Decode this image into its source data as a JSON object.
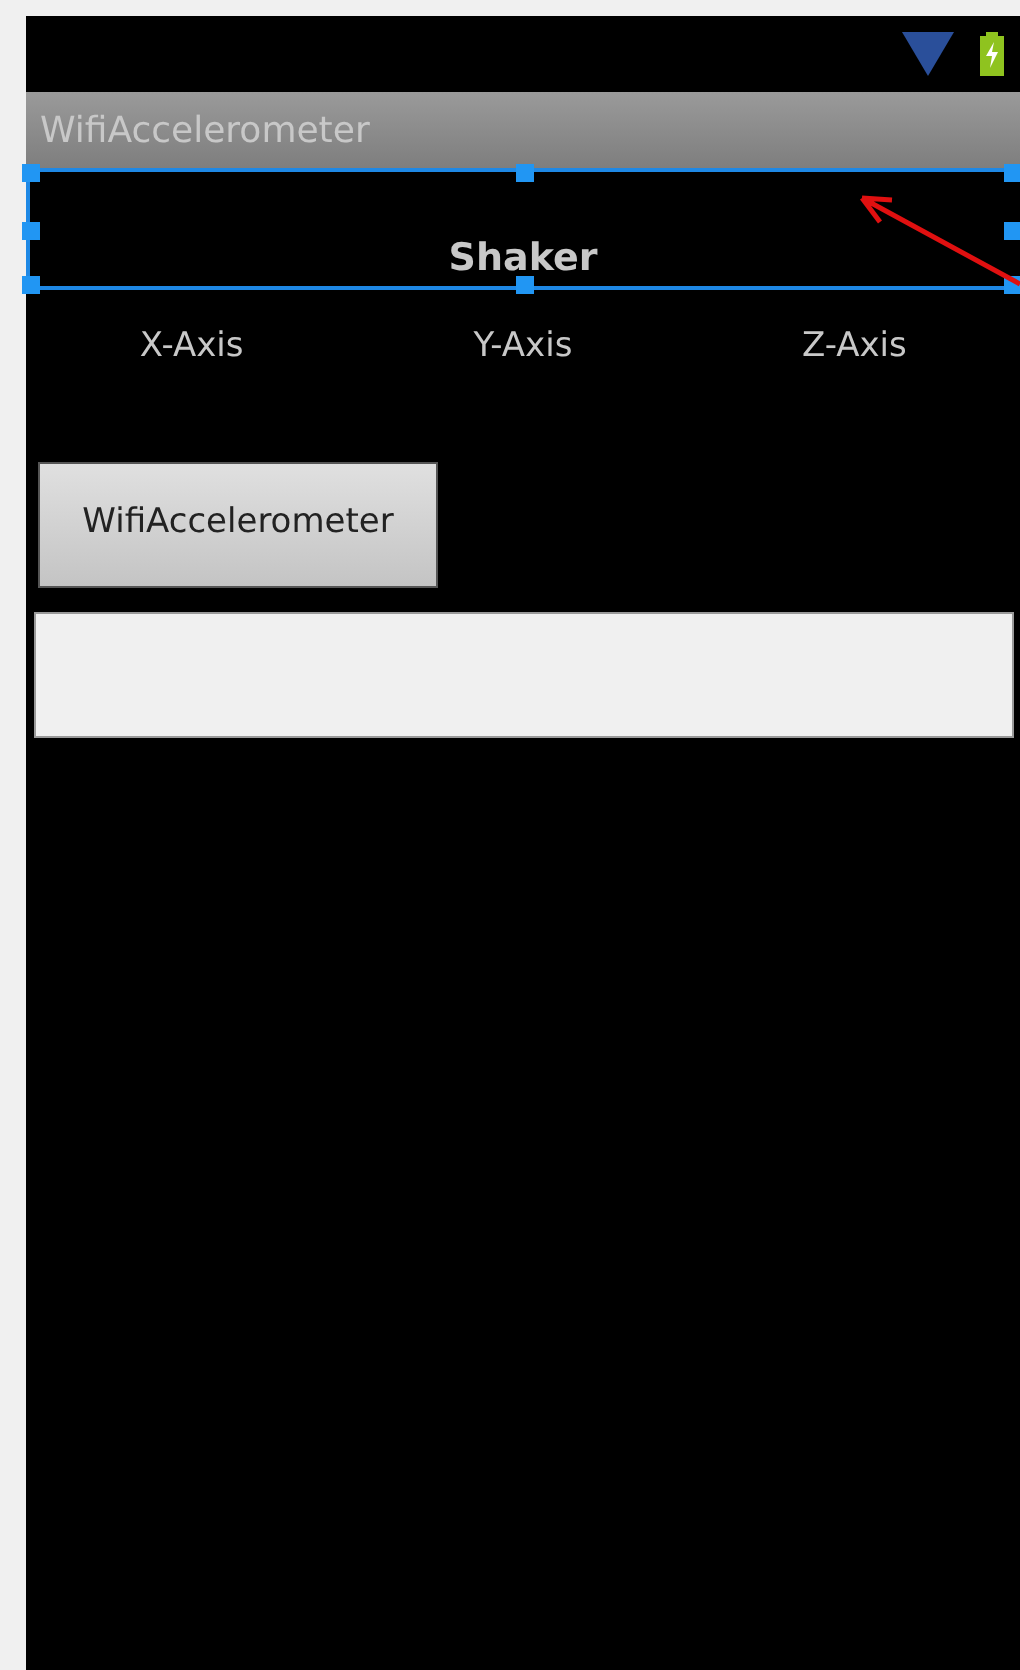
{
  "app_bar": {
    "title": "WifiAccelerometer"
  },
  "heading": {
    "text": "Shaker",
    "selected": true
  },
  "axes": [
    "X-Axis",
    "Y-Axis",
    "Z-Axis"
  ],
  "button": {
    "label": "WifiAccelerometer"
  }
}
